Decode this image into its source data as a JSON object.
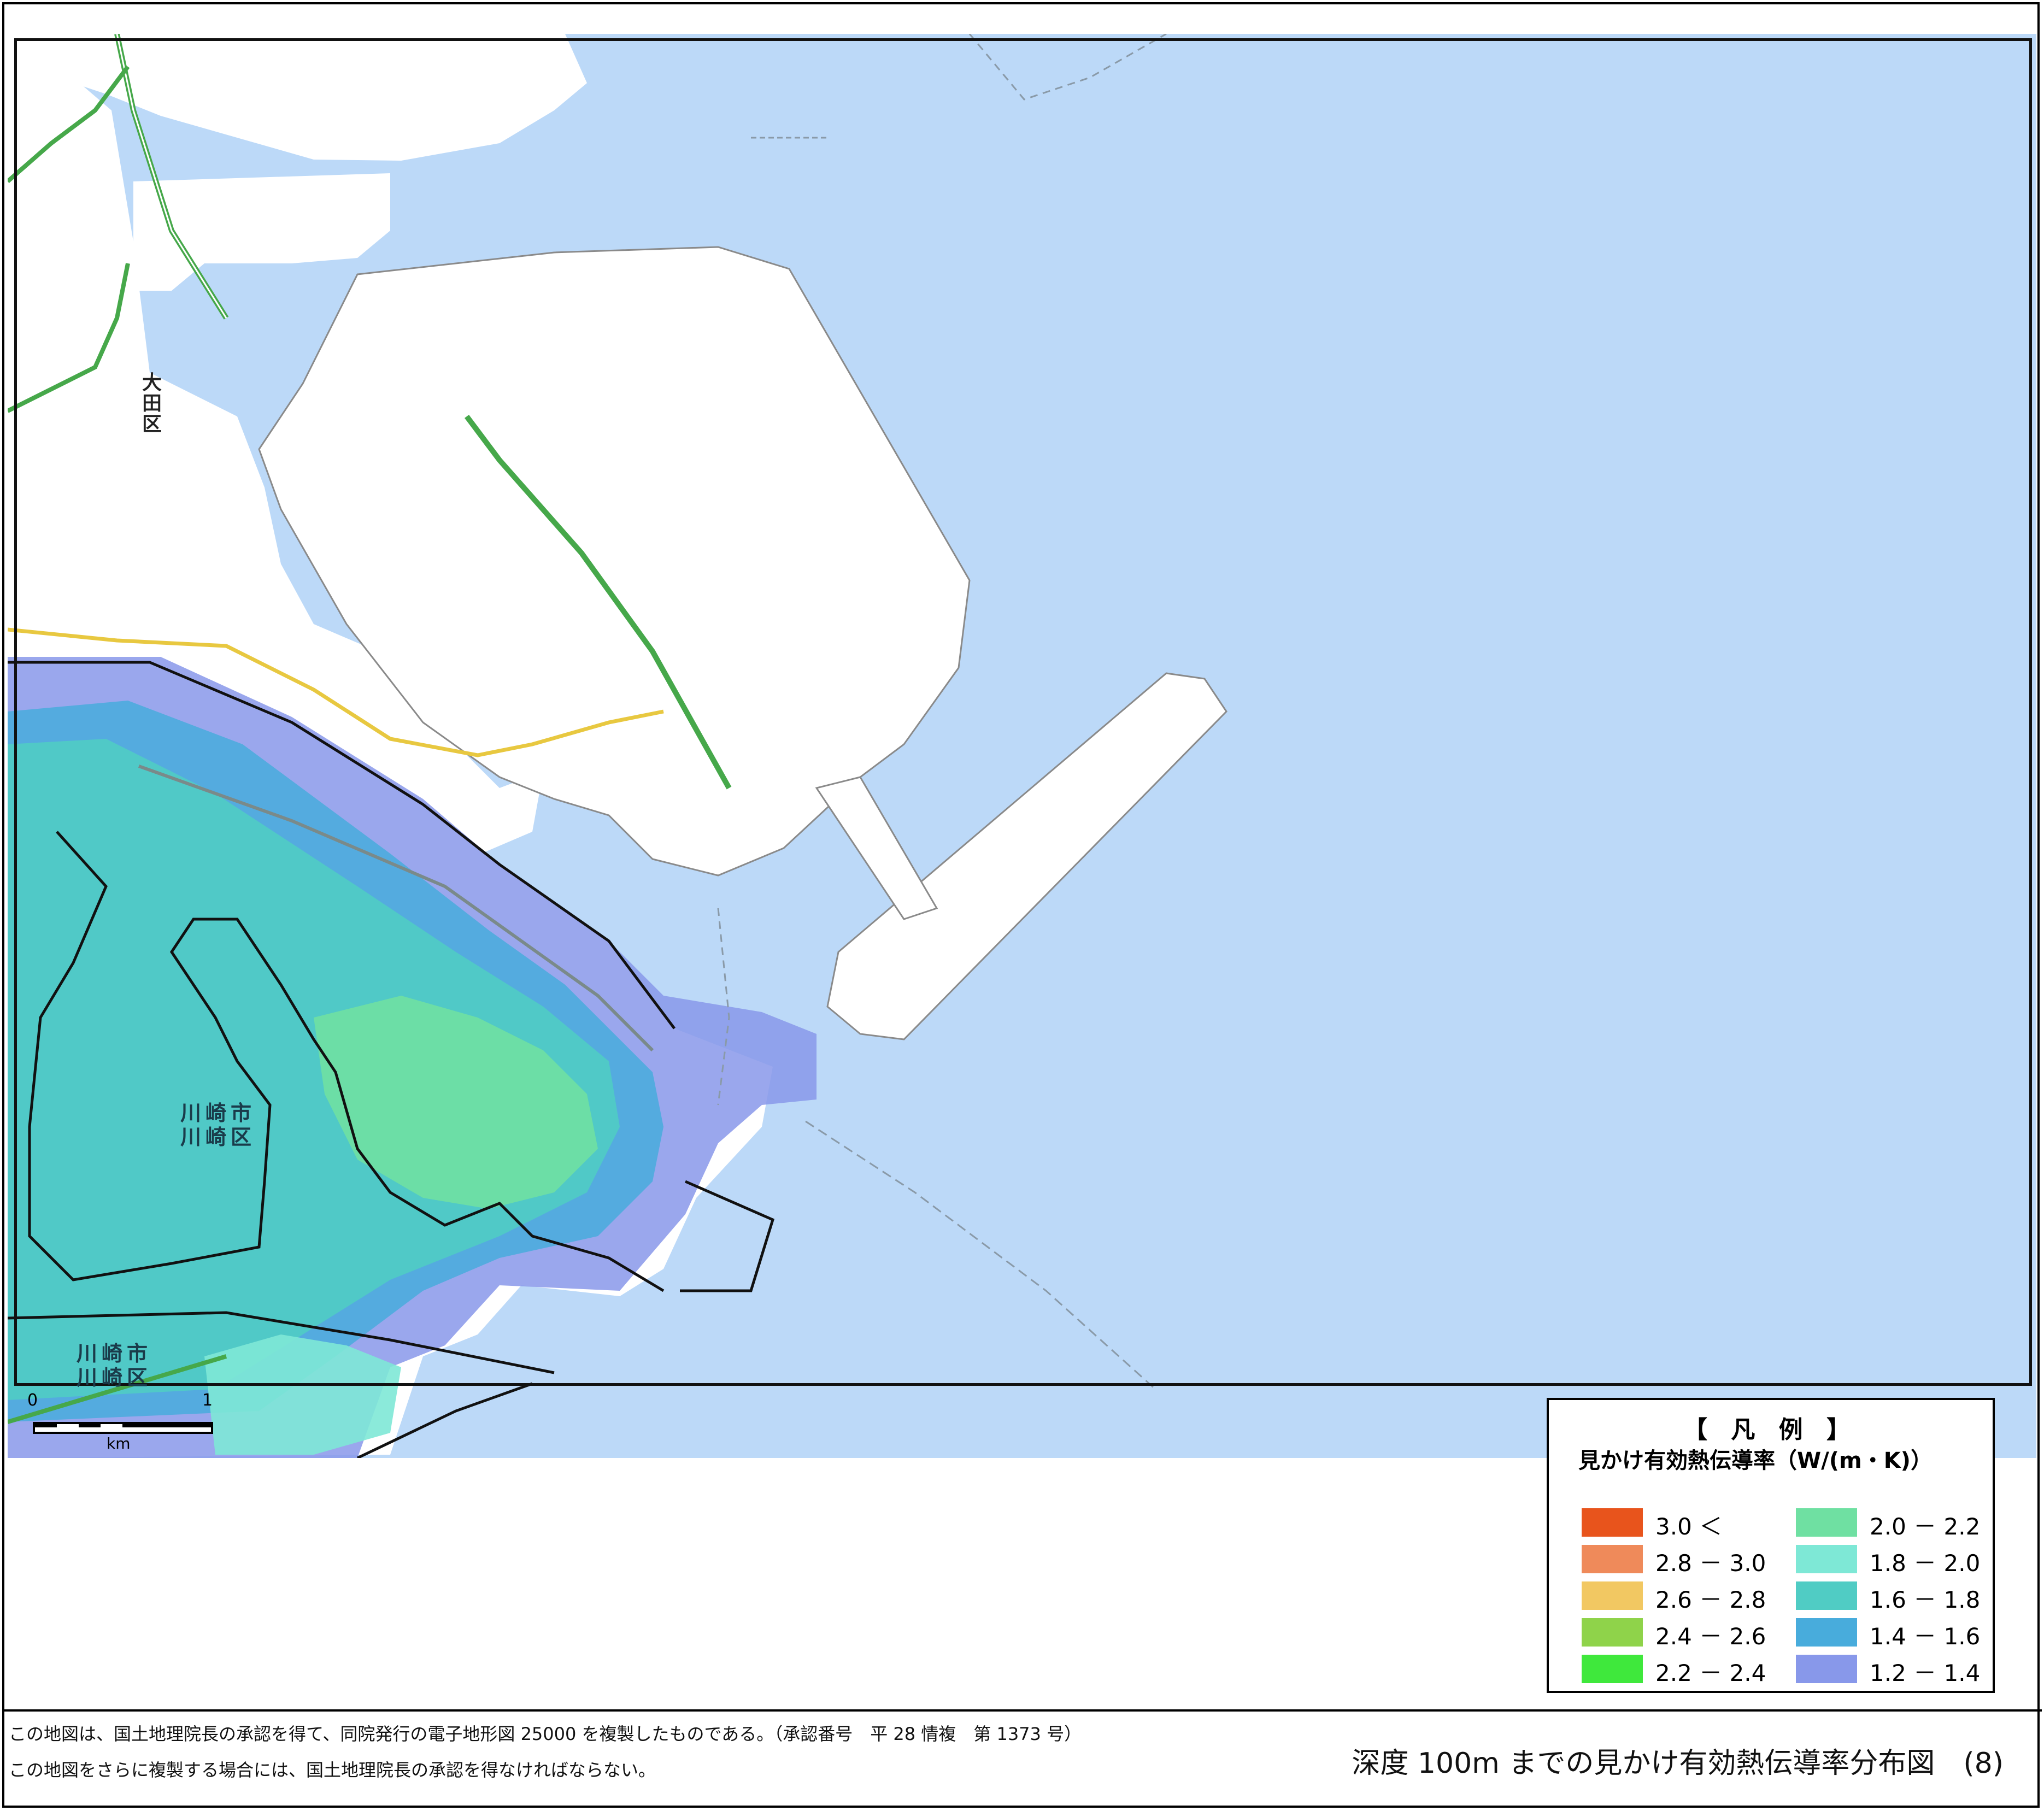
{
  "map": {
    "place_labels": [
      {
        "id": "ota",
        "text": "大田区"
      },
      {
        "id": "kawasaki1_city",
        "text": "川崎市"
      },
      {
        "id": "kawasaki1_ward",
        "text": "川崎区"
      },
      {
        "id": "kawasaki2_city",
        "text": "川崎市"
      },
      {
        "id": "kawasaki2_ward",
        "text": "川崎区"
      }
    ],
    "scale_bar": {
      "start": "0",
      "end": "1",
      "unit": "km"
    },
    "colors": {
      "sea": "#bcd9f8",
      "land": "#ffffff",
      "boundary": "#111111",
      "railway": "#46a84a",
      "road": "#e8c840"
    }
  },
  "legend": {
    "title": "【 凡 例 】",
    "subtitle": "見かけ有効熱伝導率（W/(m・K)）",
    "items": [
      {
        "range": "3.0 ＜",
        "color": "#e8541c"
      },
      {
        "range": "2.8 － 3.0",
        "color": "#ef8a5a"
      },
      {
        "range": "2.6 － 2.8",
        "color": "#f2c862"
      },
      {
        "range": "2.4 － 2.6",
        "color": "#8fd34a"
      },
      {
        "range": "2.2 － 2.4",
        "color": "#3fe83c"
      },
      {
        "range": "2.0 － 2.2",
        "color": "#6fe0a2"
      },
      {
        "range": "1.8 － 2.0",
        "color": "#7ee8d6"
      },
      {
        "range": "1.6 － 1.8",
        "color": "#50ccc4"
      },
      {
        "range": "1.4 － 1.6",
        "color": "#48acdc"
      },
      {
        "range": "1.2 － 1.4",
        "color": "#8898ea"
      }
    ]
  },
  "footer": {
    "note1": "この地図は、国土地理院長の承認を得て、同院発行の電子地形図 25000 を複製したものである。（承認番号　平 28 情複　第 1373 号）",
    "note2": "この地図をさらに複製する場合には、国土地理院長の承認を得なければならない。",
    "title": "深度 100m までの見かけ有効熱伝導率分布図　(8)"
  }
}
